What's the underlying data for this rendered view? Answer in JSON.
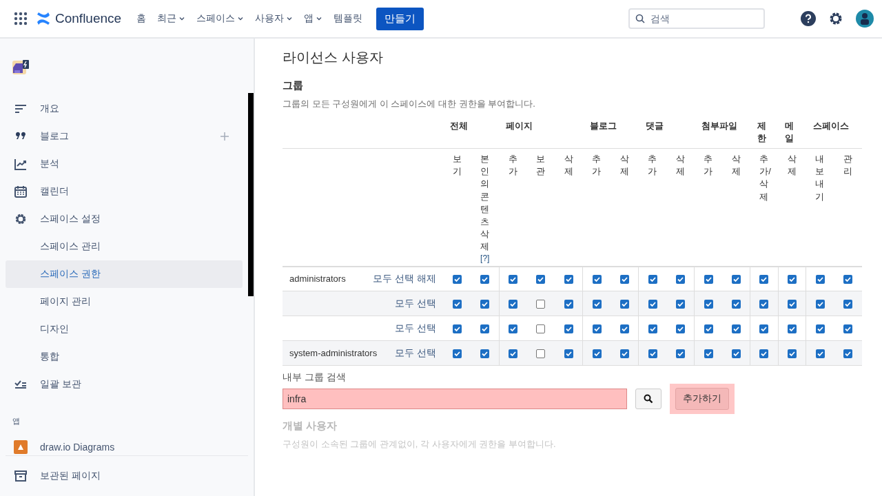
{
  "topnav": {
    "product": "Confluence",
    "items": [
      {
        "label": "홈",
        "dropdown": false
      },
      {
        "label": "최근",
        "dropdown": true
      },
      {
        "label": "스페이스",
        "dropdown": true
      },
      {
        "label": "사용자",
        "dropdown": true
      },
      {
        "label": "앱",
        "dropdown": true
      },
      {
        "label": "템플릿",
        "dropdown": false
      }
    ],
    "create_button": "만들기",
    "search": {
      "placeholder": "검색"
    }
  },
  "sidebar": {
    "items": [
      {
        "label": "개요",
        "selected": false
      },
      {
        "label": "블로그",
        "selected": false,
        "add": true
      },
      {
        "label": "분석",
        "selected": false
      },
      {
        "label": "캘린더",
        "selected": false
      },
      {
        "label": "스페이스 설정",
        "selected": false,
        "children": [
          {
            "label": "스페이스 관리",
            "selected": false
          },
          {
            "label": "스페이스 권한",
            "selected": true
          },
          {
            "label": "페이지 관리",
            "selected": false
          },
          {
            "label": "디자인",
            "selected": false
          },
          {
            "label": "통합",
            "selected": false
          }
        ]
      },
      {
        "label": "일괄 보관",
        "selected": false
      }
    ],
    "apps_heading": "앱",
    "apps": [
      {
        "label": "draw.io Diagrams"
      }
    ],
    "footer_item": "보관된 페이지"
  },
  "main": {
    "title": "라이선스 사용자",
    "section": "그룹",
    "description": "그룹의 모든 구성원에게 이 스페이스에 대한 권한을 부여합니다.",
    "table": {
      "groups": [
        {
          "label": "전체",
          "columns": [
            {
              "label": "보기"
            },
            {
              "label": "본인의콘텐츠삭제",
              "link": "[?]"
            }
          ]
        },
        {
          "label": "페이지",
          "columns": [
            {
              "label": "추가"
            },
            {
              "label": "보관"
            },
            {
              "label": "삭제"
            }
          ]
        },
        {
          "label": "블로그",
          "columns": [
            {
              "label": "추가"
            },
            {
              "label": "삭제"
            }
          ]
        },
        {
          "label": "댓글",
          "columns": [
            {
              "label": "추가"
            },
            {
              "label": "삭제"
            }
          ]
        },
        {
          "label": "첨부파일",
          "columns": [
            {
              "label": "추가"
            },
            {
              "label": "삭제"
            }
          ]
        },
        {
          "label": "제한",
          "columns": [
            {
              "label": "추가/삭제"
            }
          ]
        },
        {
          "label": "메일",
          "columns": [
            {
              "label": "삭제"
            }
          ]
        },
        {
          "label": "스페이스",
          "columns": [
            {
              "label": "내보내기"
            },
            {
              "label": "관리"
            }
          ]
        }
      ],
      "rows": [
        {
          "group": "administrators",
          "action": "모두 선택 해제",
          "perms": [
            true,
            true,
            true,
            true,
            true,
            true,
            true,
            true,
            true,
            true,
            true,
            true,
            true,
            true,
            true
          ]
        },
        {
          "action": "모두 선택",
          "perms": [
            true,
            true,
            true,
            false,
            true,
            true,
            true,
            true,
            true,
            true,
            true,
            true,
            true,
            true,
            true
          ]
        },
        {
          "action": "모두 선택",
          "perms": [
            true,
            true,
            true,
            false,
            true,
            true,
            true,
            true,
            true,
            true,
            true,
            true,
            true,
            true,
            true
          ]
        },
        {
          "group": "system-administrators",
          "action": "모두 선택",
          "perms": [
            true,
            true,
            true,
            false,
            true,
            true,
            true,
            true,
            true,
            true,
            true,
            true,
            true,
            true,
            true
          ]
        }
      ]
    },
    "group_search": {
      "label": "내부 그룹 검색",
      "value": "infra",
      "add_button": "추가하기"
    },
    "individual": {
      "section": "개별 사용자",
      "description": "구성원이 소속된 그룹에 관계없이, 각 사용자에게 권한을 부여합니다."
    }
  }
}
